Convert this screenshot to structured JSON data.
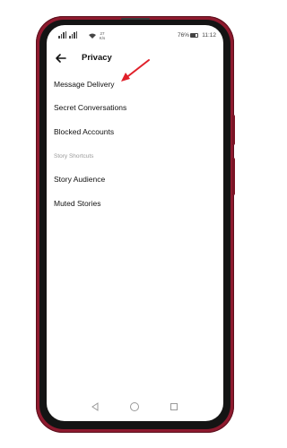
{
  "status_bar": {
    "signal_label": "4G",
    "net_speed_top": "27",
    "net_speed_bottom": "K/s",
    "battery": "76%",
    "time": "11:12"
  },
  "header": {
    "title": "Privacy"
  },
  "menu": {
    "items": [
      {
        "label": "Message Delivery"
      },
      {
        "label": "Secret Conversations"
      },
      {
        "label": "Blocked Accounts"
      }
    ],
    "section_header": "Story Shortcuts",
    "story_items": [
      {
        "label": "Story Audience"
      },
      {
        "label": "Muted Stories"
      }
    ]
  },
  "colors": {
    "phone_frame": "#8e1a2e",
    "annotation_arrow": "#e0202a",
    "section_header": "#9a9a9a"
  }
}
